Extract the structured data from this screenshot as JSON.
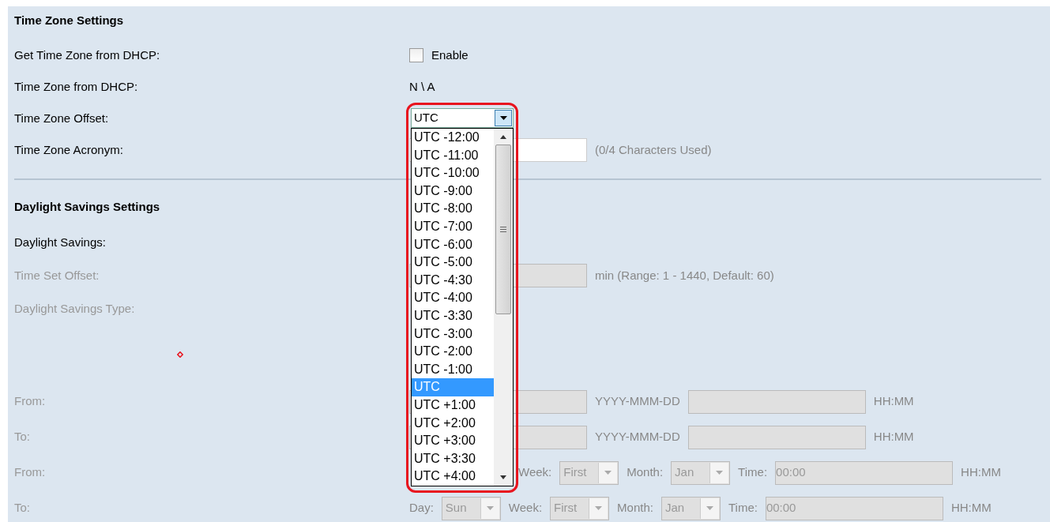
{
  "sections": [
    {
      "title": "Time Zone Settings",
      "rows": [
        {
          "kind": "checkbox",
          "label": "Get Time Zone from DHCP:",
          "disabled": false,
          "checked": false,
          "option": "Enable"
        },
        {
          "kind": "text",
          "label": "Time Zone from DHCP:",
          "disabled": false,
          "value": "N \\ A"
        },
        {
          "kind": "dropdown",
          "label": "Time Zone Offset:",
          "disabled": false,
          "value": "UTC",
          "expanded": true,
          "options": [
            {
              "label": "UTC -12:00",
              "selected": false
            },
            {
              "label": "UTC -11:00",
              "selected": false
            },
            {
              "label": "UTC -10:00",
              "selected": false
            },
            {
              "label": "UTC -9:00",
              "selected": false
            },
            {
              "label": "UTC -8:00",
              "selected": false
            },
            {
              "label": "UTC -7:00",
              "selected": false
            },
            {
              "label": "UTC -6:00",
              "selected": false
            },
            {
              "label": "UTC -5:00",
              "selected": false
            },
            {
              "label": "UTC -4:30",
              "selected": false
            },
            {
              "label": "UTC -4:00",
              "selected": false
            },
            {
              "label": "UTC -3:30",
              "selected": false
            },
            {
              "label": "UTC -3:00",
              "selected": false
            },
            {
              "label": "UTC -2:00",
              "selected": false
            },
            {
              "label": "UTC -1:00",
              "selected": false
            },
            {
              "label": "UTC",
              "selected": true
            },
            {
              "label": "UTC +1:00",
              "selected": false
            },
            {
              "label": "UTC +2:00",
              "selected": false
            },
            {
              "label": "UTC +3:00",
              "selected": false
            },
            {
              "label": "UTC +3:30",
              "selected": false
            },
            {
              "label": "UTC +4:00",
              "selected": false
            }
          ]
        },
        {
          "kind": "input",
          "label": "Time Zone Acronym:",
          "disabled": false,
          "hint": "(0/4 Characters Used)"
        }
      ]
    },
    {
      "title": "Daylight Savings Settings",
      "rows": [
        {
          "kind": "label",
          "label": "Daylight Savings:",
          "disabled": false
        },
        {
          "kind": "input",
          "label": "Time Set Offset:",
          "disabled": true,
          "hint": "min (Range: 1 - 1440, Default: 60)"
        },
        {
          "kind": "label",
          "label": "Daylight Savings Type:",
          "disabled": true
        },
        {
          "kind": "marker"
        },
        {
          "kind": "date",
          "label": "From:",
          "disabled": true,
          "date_hint": "YYYY-MMM-DD",
          "time_hint": "HH:MM"
        },
        {
          "kind": "date",
          "label": "To:",
          "disabled": true,
          "date_hint": "YYYY-MMM-DD",
          "time_hint": "HH:MM"
        },
        {
          "kind": "recurring",
          "label": "From:",
          "disabled": true,
          "week_label": "Week:",
          "week": "First",
          "month_label": "Month:",
          "month": "Jan",
          "time_label": "Time:",
          "time": "00:00",
          "time_hint": "HH:MM"
        },
        {
          "kind": "recurring",
          "label": "To:",
          "disabled": true,
          "day_label": "Day:",
          "day": "Sun",
          "week_label": "Week:",
          "week": "First",
          "month_label": "Month:",
          "month": "Jan",
          "time_label": "Time:",
          "time": "00:00",
          "time_hint": "HH:MM"
        }
      ]
    }
  ]
}
